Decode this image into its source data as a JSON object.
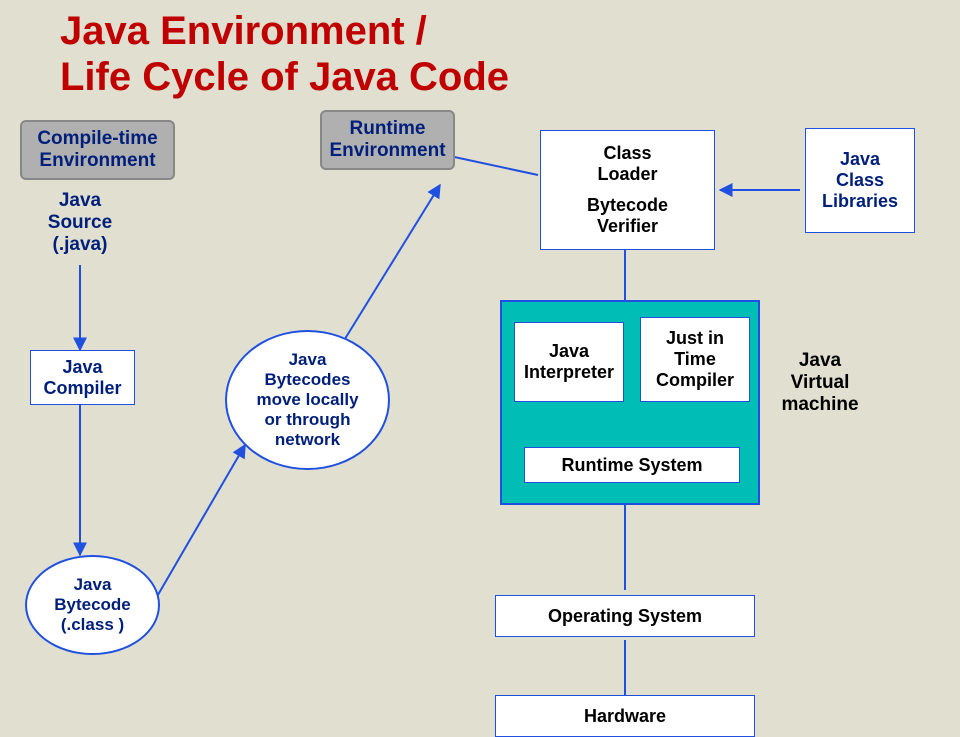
{
  "title_line1": "Java Environment /",
  "title_line2": "Life Cycle of Java Code",
  "boxes": {
    "compile_env": "Compile-time\nEnvironment",
    "runtime_env": "Runtime\nEnvironment",
    "java_source": "Java\nSource\n(.java)",
    "class_loader": "Class\nLoader",
    "bytecode_verifier": "Bytecode\nVerifier",
    "class_libraries": "Java\nClass\nLibraries",
    "java_compiler": "Java\nCompiler",
    "bytecodes_move": "Java\nBytecodes\nmove locally\nor through\nnetwork",
    "interpreter": "Java\nInterpreter",
    "jit": "Just in\nTime\nCompiler",
    "jvm_label": "Java\nVirtual\nmachine",
    "runtime_system": "Runtime System",
    "java_bytecode": "Java\nBytecode\n(.class )",
    "os": "Operating System",
    "hardware": "Hardware"
  }
}
